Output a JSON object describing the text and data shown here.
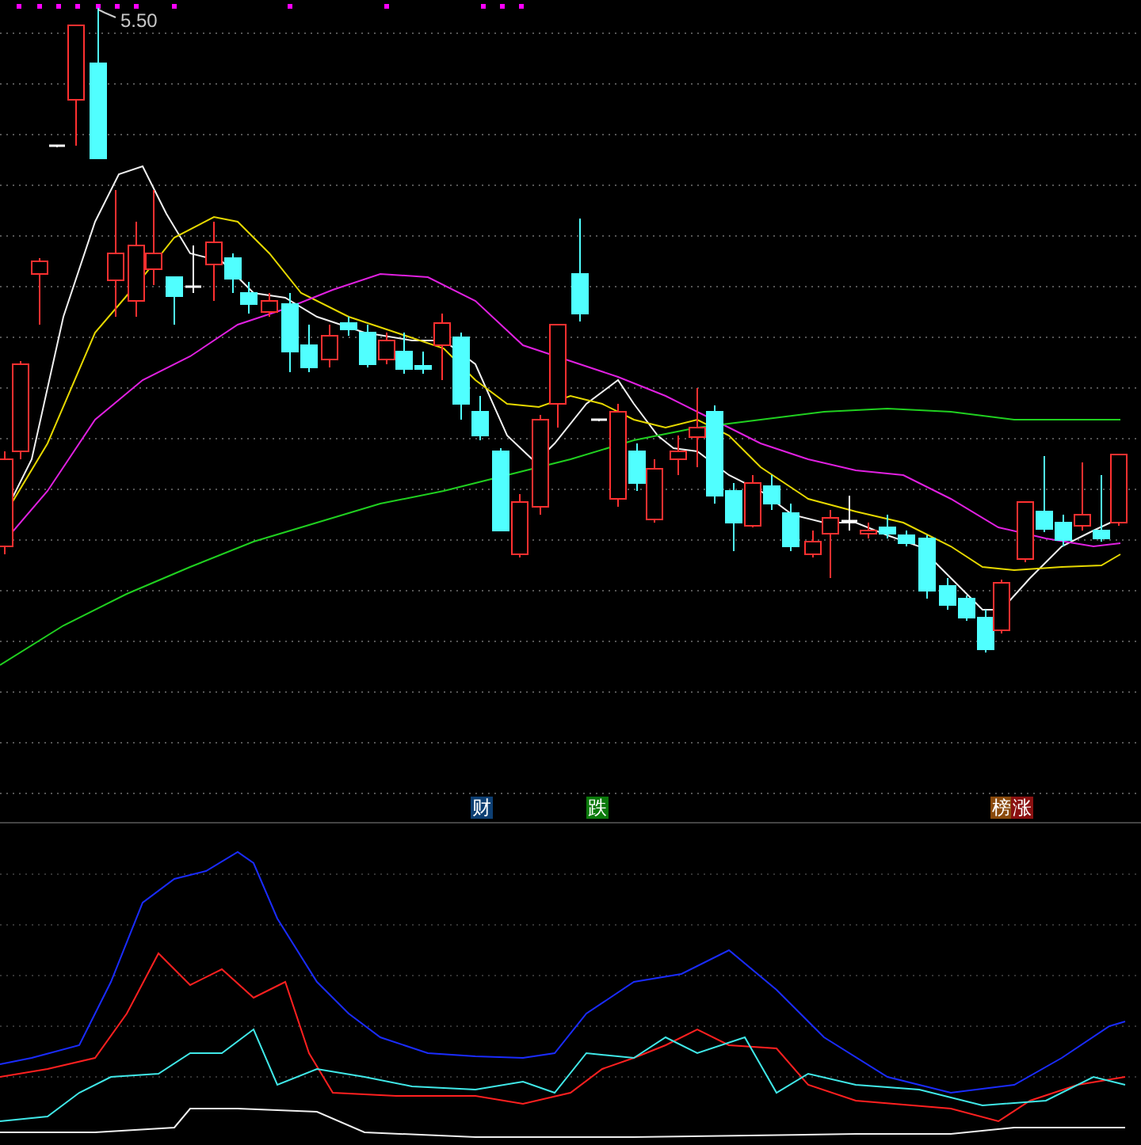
{
  "price_label": "5.50",
  "signals": [
    {
      "text": "财",
      "color": "#0d3f73"
    },
    {
      "text": "跌",
      "color": "#0b7a0b"
    },
    {
      "text": "榜",
      "color": "#8a4a0c"
    },
    {
      "text": "涨",
      "color": "#8a1010"
    }
  ]
}
